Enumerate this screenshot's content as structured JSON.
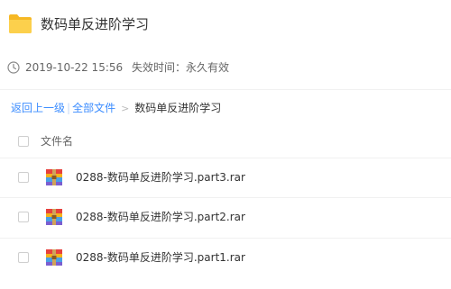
{
  "header": {
    "title": "数码单反进阶学习",
    "folder_icon": "folder-icon",
    "folder_color": "#f9c73c"
  },
  "meta": {
    "date": "2019-10-22 15:56",
    "expire": "失效时间：永久有效",
    "clock_icon": "clock-icon"
  },
  "breadcrumb": {
    "back": "返回上一级",
    "separator": "|",
    "all_files": "全部文件",
    "arrow": ">",
    "current": "数码单反进阶学习",
    "link_color": "#3b8cff"
  },
  "table": {
    "column_header": "文件名",
    "rows": [
      {
        "name": "0288-数码单反进阶学习.part3.rar",
        "icon": "rar-archive-icon"
      },
      {
        "name": "0288-数码单反进阶学习.part2.rar",
        "icon": "rar-archive-icon"
      },
      {
        "name": "0288-数码单反进阶学习.part1.rar",
        "icon": "rar-archive-icon"
      }
    ]
  }
}
